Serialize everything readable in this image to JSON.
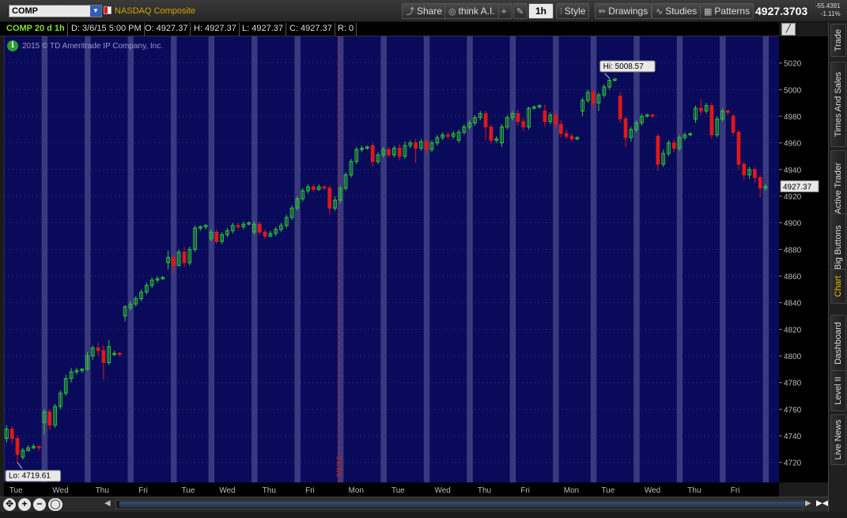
{
  "toolbar": {
    "symbol": "COMP",
    "company": "NASDAQ Composite",
    "buttons": [
      {
        "id": "share",
        "label": "Share",
        "icon": "share-icon"
      },
      {
        "id": "think",
        "label": "think A.I.",
        "icon": "think-icon"
      },
      {
        "id": "timeframe",
        "label": "1h",
        "icon": ""
      },
      {
        "id": "style",
        "label": "Style",
        "icon": "style-icon"
      },
      {
        "id": "drawings",
        "label": "Drawings",
        "icon": "pencil-icon"
      },
      {
        "id": "studies",
        "label": "Studies",
        "icon": "studies-icon"
      },
      {
        "id": "patterns",
        "label": "Patterns",
        "icon": "patterns-icon"
      }
    ],
    "last_price": "4927.3703",
    "net_change": "-55.4391",
    "net_change_pct": "-1.11%"
  },
  "header": {
    "symbol_period": "COMP 20 d 1h",
    "date": "D: 3/6/15 5:00 PM",
    "open": "O: 4927.37",
    "high": "H: 4927.37",
    "low": "L: 4927.37",
    "close": "C: 4927.37",
    "range": "R: 0"
  },
  "copyright": "2015 © TD Ameritrade IP Company, Inc.",
  "side_tabs": [
    "Trade",
    "Times And Sales",
    "Active Trader",
    "Big Buttons",
    "Chart",
    "Dashboard",
    "Level II",
    "Live News"
  ],
  "active_tab": "Chart",
  "colors": {
    "chart_bg": "#0a0a5a",
    "shade": "#4a4a8c",
    "up": "#2ecc2e",
    "down": "#e01818",
    "grid": "#3a3a80",
    "ext": "#e0e0e0"
  },
  "chart_data": {
    "type": "candlestick",
    "ylim": [
      4705,
      5040
    ],
    "yticks": [
      4720,
      4740,
      4760,
      4780,
      4800,
      4820,
      4840,
      4860,
      4880,
      4900,
      4920,
      4940,
      4960,
      4980,
      5000,
      5020
    ],
    "day_labels": [
      "Tue",
      "Wed",
      "Thu",
      "Fri",
      "Tue",
      "Wed",
      "Thu",
      "Fri",
      "Mon",
      "Tue",
      "Wed",
      "Thu",
      "Fri",
      "Mon",
      "Tue",
      "Wed",
      "Thu",
      "Fri"
    ],
    "month_divider_label": "3/2/15",
    "high_label": "Hi: 5008.57",
    "low_label": "Lo: 4719.61",
    "current_label": "4927.37",
    "days": [
      {
        "o": 4738,
        "c": 4745,
        "h": 4748,
        "l": 4735
      },
      {
        "o": 4745,
        "c": 4738,
        "h": 4747,
        "l": 4734
      },
      {
        "o": 4738,
        "c": 4726,
        "h": 4740,
        "l": 4720
      },
      {
        "o": 4724,
        "c": 4729,
        "h": 4731,
        "l": 4722
      },
      {
        "o": 4729,
        "c": 4731,
        "h": 4733,
        "l": 4728
      },
      {
        "o": 4731,
        "c": 4732,
        "h": 4734,
        "l": 4730
      },
      {
        "o": 4732,
        "c": 4731,
        "h": 4733,
        "l": 4729
      },
      {
        "o": 4750,
        "c": 4758,
        "h": 4760,
        "l": 4741
      },
      {
        "o": 4758,
        "c": 4748,
        "h": 4760,
        "l": 4744
      },
      {
        "o": 4748,
        "c": 4762,
        "h": 4764,
        "l": 4746
      },
      {
        "o": 4762,
        "c": 4772,
        "h": 4774,
        "l": 4760
      },
      {
        "o": 4772,
        "c": 4783,
        "h": 4786,
        "l": 4770
      },
      {
        "o": 4783,
        "c": 4788,
        "h": 4791,
        "l": 4780
      },
      {
        "o": 4788,
        "c": 4789,
        "h": 4791,
        "l": 4786
      },
      {
        "o": 4789,
        "c": 4790,
        "h": 4791,
        "l": 4787
      },
      {
        "o": 4790,
        "c": 4800,
        "h": 4803,
        "l": 4789
      },
      {
        "o": 4800,
        "c": 4806,
        "h": 4808,
        "l": 4797
      },
      {
        "o": 4806,
        "c": 4804,
        "h": 4810,
        "l": 4800
      },
      {
        "o": 4804,
        "c": 4795,
        "h": 4808,
        "l": 4782
      },
      {
        "o": 4795,
        "c": 4807,
        "h": 4812,
        "l": 4793
      },
      {
        "o": 4801,
        "c": 4802,
        "h": 4804,
        "l": 4800
      },
      {
        "o": 4802,
        "c": 4801,
        "h": 4803,
        "l": 4800
      },
      {
        "o": 4830,
        "c": 4837,
        "h": 4838,
        "l": 4826
      },
      {
        "o": 4836,
        "c": 4839,
        "h": 4841,
        "l": 4834
      },
      {
        "o": 4839,
        "c": 4843,
        "h": 4845,
        "l": 4837
      },
      {
        "o": 4843,
        "c": 4848,
        "h": 4850,
        "l": 4841
      },
      {
        "o": 4848,
        "c": 4853,
        "h": 4855,
        "l": 4846
      },
      {
        "o": 4853,
        "c": 4857,
        "h": 4859,
        "l": 4851
      },
      {
        "o": 4857,
        "c": 4858,
        "h": 4860,
        "l": 4855
      },
      {
        "o": 4858,
        "c": 4859,
        "h": 4860,
        "l": 4857
      },
      {
        "o": 4870,
        "c": 4874,
        "h": 4879,
        "l": 4865
      },
      {
        "o": 4874,
        "c": 4868,
        "h": 4876,
        "l": 4862
      },
      {
        "o": 4868,
        "c": 4878,
        "h": 4880,
        "l": 4867
      },
      {
        "o": 4878,
        "c": 4870,
        "h": 4882,
        "l": 4867
      },
      {
        "o": 4870,
        "c": 4880,
        "h": 4882,
        "l": 4868
      },
      {
        "o": 4880,
        "c": 4896,
        "h": 4898,
        "l": 4878
      },
      {
        "o": 4896,
        "c": 4897,
        "h": 4898,
        "l": 4894
      },
      {
        "o": 4897,
        "c": 4898,
        "h": 4899,
        "l": 4895
      },
      {
        "o": 4888,
        "c": 4893,
        "h": 4895,
        "l": 4886
      },
      {
        "o": 4893,
        "c": 4886,
        "h": 4895,
        "l": 4884
      },
      {
        "o": 4886,
        "c": 4891,
        "h": 4893,
        "l": 4884
      },
      {
        "o": 4891,
        "c": 4894,
        "h": 4896,
        "l": 4889
      },
      {
        "o": 4894,
        "c": 4898,
        "h": 4900,
        "l": 4892
      },
      {
        "o": 4898,
        "c": 4897,
        "h": 4900,
        "l": 4895
      },
      {
        "o": 4897,
        "c": 4899,
        "h": 4901,
        "l": 4895
      },
      {
        "o": 4899,
        "c": 4900,
        "h": 4901,
        "l": 4898
      },
      {
        "o": 4893,
        "c": 4899,
        "h": 4901,
        "l": 4891
      },
      {
        "o": 4899,
        "c": 4893,
        "h": 4901,
        "l": 4891
      },
      {
        "o": 4893,
        "c": 4890,
        "h": 4895,
        "l": 4888
      },
      {
        "o": 4890,
        "c": 4892,
        "h": 4894,
        "l": 4889
      },
      {
        "o": 4892,
        "c": 4895,
        "h": 4897,
        "l": 4890
      },
      {
        "o": 4895,
        "c": 4898,
        "h": 4900,
        "l": 4893
      },
      {
        "o": 4898,
        "c": 4904,
        "h": 4906,
        "l": 4896
      },
      {
        "o": 4904,
        "c": 4911,
        "h": 4913,
        "l": 4902
      },
      {
        "o": 4911,
        "c": 4918,
        "h": 4920,
        "l": 4909
      },
      {
        "o": 4918,
        "c": 4924,
        "h": 4926,
        "l": 4916
      },
      {
        "o": 4924,
        "c": 4927,
        "h": 4929,
        "l": 4922
      },
      {
        "o": 4927,
        "c": 4925,
        "h": 4929,
        "l": 4923
      },
      {
        "o": 4925,
        "c": 4927,
        "h": 4929,
        "l": 4924
      },
      {
        "o": 4927,
        "c": 4926,
        "h": 4928,
        "l": 4925
      },
      {
        "o": 4926,
        "c": 4911,
        "h": 4928,
        "l": 4906
      },
      {
        "o": 4911,
        "c": 4917,
        "h": 4920,
        "l": 4909
      },
      {
        "o": 4917,
        "c": 4926,
        "h": 4928,
        "l": 4915
      },
      {
        "o": 4926,
        "c": 4936,
        "h": 4938,
        "l": 4924
      },
      {
        "o": 4936,
        "c": 4946,
        "h": 4948,
        "l": 4934
      },
      {
        "o": 4946,
        "c": 4955,
        "h": 4957,
        "l": 4944
      },
      {
        "o": 4955,
        "c": 4956,
        "h": 4958,
        "l": 4953
      },
      {
        "o": 4956,
        "c": 4957,
        "h": 4958,
        "l": 4955
      },
      {
        "o": 4958,
        "c": 4946,
        "h": 4960,
        "l": 4942
      },
      {
        "o": 4946,
        "c": 4951,
        "h": 4953,
        "l": 4944
      },
      {
        "o": 4951,
        "c": 4955,
        "h": 4957,
        "l": 4949
      },
      {
        "o": 4955,
        "c": 4951,
        "h": 4957,
        "l": 4949
      },
      {
        "o": 4951,
        "c": 4956,
        "h": 4958,
        "l": 4949
      },
      {
        "o": 4956,
        "c": 4950,
        "h": 4959,
        "l": 4947
      },
      {
        "o": 4950,
        "c": 4958,
        "h": 4961,
        "l": 4948
      },
      {
        "o": 4958,
        "c": 4960,
        "h": 4962,
        "l": 4956
      },
      {
        "o": 4960,
        "c": 4956,
        "h": 4963,
        "l": 4945
      },
      {
        "o": 4956,
        "c": 4961,
        "h": 4963,
        "l": 4954
      },
      {
        "o": 4961,
        "c": 4955,
        "h": 4963,
        "l": 4952
      },
      {
        "o": 4955,
        "c": 4960,
        "h": 4962,
        "l": 4953
      },
      {
        "o": 4960,
        "c": 4964,
        "h": 4966,
        "l": 4958
      },
      {
        "o": 4964,
        "c": 4966,
        "h": 4968,
        "l": 4962
      },
      {
        "o": 4966,
        "c": 4965,
        "h": 4968,
        "l": 4963
      },
      {
        "o": 4965,
        "c": 4967,
        "h": 4969,
        "l": 4963
      },
      {
        "o": 4962,
        "c": 4968,
        "h": 4970,
        "l": 4960
      },
      {
        "o": 4968,
        "c": 4972,
        "h": 4974,
        "l": 4966
      },
      {
        "o": 4972,
        "c": 4975,
        "h": 4977,
        "l": 4970
      },
      {
        "o": 4975,
        "c": 4979,
        "h": 4981,
        "l": 4973
      },
      {
        "o": 4979,
        "c": 4982,
        "h": 4984,
        "l": 4977
      },
      {
        "o": 4982,
        "c": 4972,
        "h": 4984,
        "l": 4962
      },
      {
        "o": 4972,
        "c": 4962,
        "h": 4974,
        "l": 4959
      },
      {
        "o": 4962,
        "c": 4963,
        "h": 4965,
        "l": 4960
      },
      {
        "o": 4960,
        "c": 4972,
        "h": 4974,
        "l": 4957
      },
      {
        "o": 4972,
        "c": 4979,
        "h": 4981,
        "l": 4970
      },
      {
        "o": 4979,
        "c": 4982,
        "h": 4984,
        "l": 4977
      },
      {
        "o": 4982,
        "c": 4976,
        "h": 4985,
        "l": 4973
      },
      {
        "o": 4976,
        "c": 4972,
        "h": 4979,
        "l": 4969
      },
      {
        "o": 4972,
        "c": 4986,
        "h": 4987,
        "l": 4970
      },
      {
        "o": 4986,
        "c": 4987,
        "h": 4988,
        "l": 4985
      },
      {
        "o": 4987,
        "c": 4988,
        "h": 4989,
        "l": 4986
      },
      {
        "o": 4984,
        "c": 4976,
        "h": 4989,
        "l": 4972
      },
      {
        "o": 4976,
        "c": 4981,
        "h": 4983,
        "l": 4974
      },
      {
        "o": 4981,
        "c": 4974,
        "h": 4984,
        "l": 4971
      },
      {
        "o": 4974,
        "c": 4967,
        "h": 4977,
        "l": 4964
      },
      {
        "o": 4967,
        "c": 4965,
        "h": 4970,
        "l": 4963
      },
      {
        "o": 4965,
        "c": 4963,
        "h": 4967,
        "l": 4961
      },
      {
        "o": 4963,
        "c": 4964,
        "h": 4965,
        "l": 4962
      },
      {
        "o": 4984,
        "c": 4992,
        "h": 4994,
        "l": 4980
      },
      {
        "o": 4992,
        "c": 4998,
        "h": 5000,
        "l": 4990
      },
      {
        "o": 4998,
        "c": 4990,
        "h": 5001,
        "l": 4986
      },
      {
        "o": 4990,
        "c": 4996,
        "h": 4998,
        "l": 4984
      },
      {
        "o": 4996,
        "c": 5002,
        "h": 5004,
        "l": 4994
      },
      {
        "o": 5002,
        "c": 5007,
        "h": 5008.57,
        "l": 5000
      },
      {
        "o": 5007,
        "c": 5008,
        "h": 5008.57,
        "l": 5006
      },
      {
        "o": 4995,
        "c": 4978,
        "h": 4998,
        "l": 4975
      },
      {
        "o": 4978,
        "c": 4964,
        "h": 4980,
        "l": 4957
      },
      {
        "o": 4964,
        "c": 4970,
        "h": 4972,
        "l": 4961
      },
      {
        "o": 4970,
        "c": 4975,
        "h": 4977,
        "l": 4968
      },
      {
        "o": 4975,
        "c": 4980,
        "h": 4982,
        "l": 4973
      },
      {
        "o": 4980,
        "c": 4981,
        "h": 4982,
        "l": 4979
      },
      {
        "o": 4981,
        "c": 4980,
        "h": 4982,
        "l": 4979
      },
      {
        "o": 4965,
        "c": 4944,
        "h": 4967,
        "l": 4939
      },
      {
        "o": 4944,
        "c": 4952,
        "h": 4955,
        "l": 4942
      },
      {
        "o": 4952,
        "c": 4960,
        "h": 4962,
        "l": 4950
      },
      {
        "o": 4960,
        "c": 4956,
        "h": 4963,
        "l": 4953
      },
      {
        "o": 4956,
        "c": 4964,
        "h": 4966,
        "l": 4954
      },
      {
        "o": 4964,
        "c": 4966,
        "h": 4968,
        "l": 4962
      },
      {
        "o": 4966,
        "c": 4967,
        "h": 4968,
        "l": 4965
      },
      {
        "o": 4978,
        "c": 4986,
        "h": 4988,
        "l": 4975
      },
      {
        "o": 4986,
        "c": 4984,
        "h": 4993,
        "l": 4981
      },
      {
        "o": 4984,
        "c": 4988,
        "h": 4990,
        "l": 4982
      },
      {
        "o": 4988,
        "c": 4966,
        "h": 4990,
        "l": 4963
      },
      {
        "o": 4966,
        "c": 4978,
        "h": 4980,
        "l": 4964
      },
      {
        "o": 4978,
        "c": 4984,
        "h": 4986,
        "l": 4976
      },
      {
        "o": 4984,
        "c": 4983,
        "h": 4985,
        "l": 4981
      },
      {
        "o": 4980,
        "c": 4968,
        "h": 4982,
        "l": 4965
      },
      {
        "o": 4968,
        "c": 4944,
        "h": 4970,
        "l": 4940
      },
      {
        "o": 4944,
        "c": 4936,
        "h": 4946,
        "l": 4932
      },
      {
        "o": 4936,
        "c": 4940,
        "h": 4942,
        "l": 4933
      },
      {
        "o": 4940,
        "c": 4934,
        "h": 4942,
        "l": 4930
      },
      {
        "o": 4934,
        "c": 4926,
        "h": 4936,
        "l": 4919
      },
      {
        "o": 4926,
        "c": 4927.37,
        "h": 4929,
        "l": 4924
      }
    ]
  }
}
